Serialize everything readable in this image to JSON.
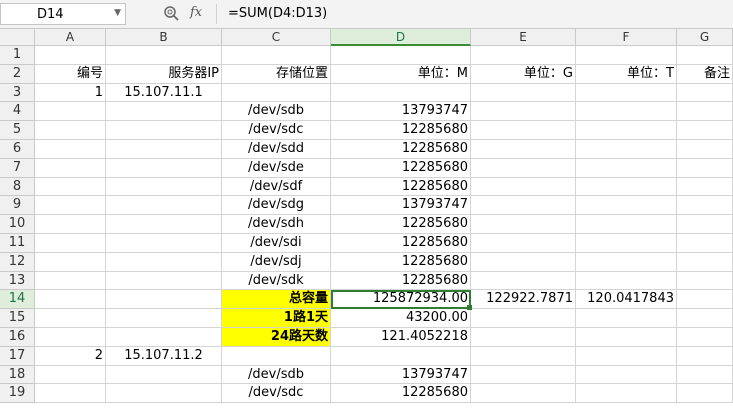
{
  "formula_bar": {
    "name_box": "D14",
    "fx_label": "fx",
    "formula": "=SUM(D4:D13)"
  },
  "columns": [
    "A",
    "B",
    "C",
    "D",
    "E",
    "F",
    "G"
  ],
  "rows": [
    {
      "num": "1",
      "cells": [
        "",
        "",
        "",
        "",
        "",
        "",
        ""
      ]
    },
    {
      "num": "2",
      "cells": [
        "编号",
        "服务器IP",
        "存储位置",
        "单位：M",
        "单位：G",
        "单位：T",
        "备注"
      ]
    },
    {
      "num": "3",
      "cells": [
        "1",
        "15.107.11.1",
        "",
        "",
        "",
        "",
        ""
      ]
    },
    {
      "num": "4",
      "cells": [
        "",
        "",
        "/dev/sdb",
        "13793747",
        "",
        "",
        ""
      ]
    },
    {
      "num": "5",
      "cells": [
        "",
        "",
        "/dev/sdc",
        "12285680",
        "",
        "",
        ""
      ]
    },
    {
      "num": "6",
      "cells": [
        "",
        "",
        "/dev/sdd",
        "12285680",
        "",
        "",
        ""
      ]
    },
    {
      "num": "7",
      "cells": [
        "",
        "",
        "/dev/sde",
        "12285680",
        "",
        "",
        ""
      ]
    },
    {
      "num": "8",
      "cells": [
        "",
        "",
        "/dev/sdf",
        "12285680",
        "",
        "",
        ""
      ]
    },
    {
      "num": "9",
      "cells": [
        "",
        "",
        "/dev/sdg",
        "13793747",
        "",
        "",
        ""
      ]
    },
    {
      "num": "10",
      "cells": [
        "",
        "",
        "/dev/sdh",
        "12285680",
        "",
        "",
        ""
      ]
    },
    {
      "num": "11",
      "cells": [
        "",
        "",
        "/dev/sdi",
        "12285680",
        "",
        "",
        ""
      ]
    },
    {
      "num": "12",
      "cells": [
        "",
        "",
        "/dev/sdj",
        "12285680",
        "",
        "",
        ""
      ]
    },
    {
      "num": "13",
      "cells": [
        "",
        "",
        "/dev/sdk",
        "12285680",
        "",
        "",
        ""
      ]
    },
    {
      "num": "14",
      "cells": [
        "",
        "",
        "总容量",
        "125872934.00",
        "122922.7871",
        "120.0417843",
        ""
      ]
    },
    {
      "num": "15",
      "cells": [
        "",
        "",
        "1路1天",
        "43200.00",
        "",
        "",
        ""
      ]
    },
    {
      "num": "16",
      "cells": [
        "",
        "",
        "24路天数",
        "121.4052218",
        "",
        "",
        ""
      ]
    },
    {
      "num": "17",
      "cells": [
        "2",
        "15.107.11.2",
        "",
        "",
        "",
        "",
        ""
      ]
    },
    {
      "num": "18",
      "cells": [
        "",
        "",
        "/dev/sdb",
        "13793747",
        "",
        "",
        ""
      ]
    },
    {
      "num": "19",
      "cells": [
        "",
        "",
        "/dev/sdc",
        "12285680",
        "",
        "",
        ""
      ]
    }
  ],
  "selected_cell": "D14",
  "highlight_color": "#ffff00",
  "selection_color": "#2f7d32"
}
